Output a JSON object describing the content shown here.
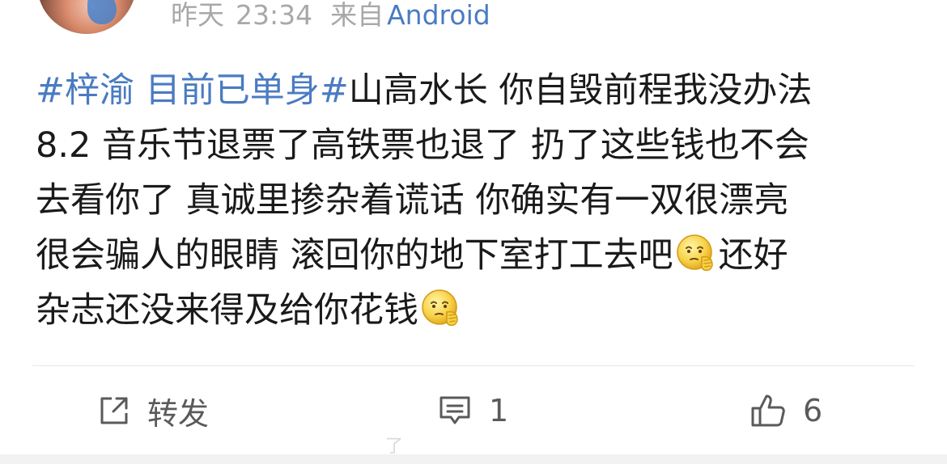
{
  "post_meta": {
    "date": "昨天",
    "time": "23:34",
    "from_label": "来自",
    "device": "Android"
  },
  "post": {
    "lines": [
      [
        {
          "type": "hashtag",
          "text": "#梓渝 目前已单身#"
        },
        {
          "type": "text",
          "text": "山高水长 你自毁前程我没办法"
        }
      ],
      [
        {
          "type": "text",
          "text": "8.2 音乐节退票了高铁票也退了 扔了这些钱也不会"
        }
      ],
      [
        {
          "type": "text",
          "text": "去看你了 真诚里掺杂着谎话 你确实有一双很漂亮"
        }
      ],
      [
        {
          "type": "text",
          "text": "很会骗人的眼睛 滚回你的地下室打工去吧"
        },
        {
          "type": "emoji",
          "name": "thinking-emoji"
        },
        {
          "type": "text",
          "text": "还好"
        }
      ],
      [
        {
          "type": "text",
          "text": "杂志还没来得及给你花钱"
        },
        {
          "type": "emoji",
          "name": "thinking-emoji"
        }
      ]
    ]
  },
  "actions": {
    "repost_label": "转发",
    "comment_count": "1",
    "like_count": "6"
  },
  "watermark": "了",
  "icons": {
    "repost": "share-out-icon",
    "comment": "comment-bubble-icon",
    "like": "thumbs-up-icon",
    "emoji": "thinking-emoji"
  },
  "colors": {
    "link": "#4a7bc2",
    "meta_gray": "#a8a8a8",
    "text": "#1a1a1a",
    "action_gray": "#5a5a5a"
  }
}
